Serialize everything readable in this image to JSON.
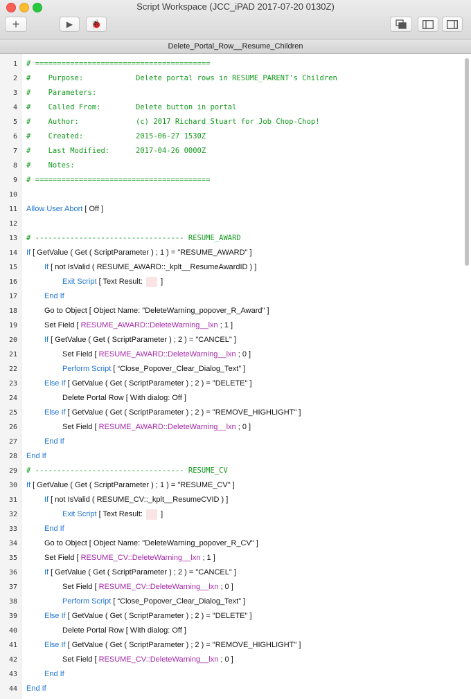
{
  "window": {
    "title": "Script Workspace (JCC_iPAD 2017-07-20 0130Z)"
  },
  "toolbar": {
    "add": "+",
    "run": "▶",
    "debug": "🐞"
  },
  "tab": {
    "label": "Delete_Portal_Row__Resume_Children"
  },
  "script": {
    "lines": [
      {
        "n": "1",
        "indent": 0,
        "segs": [
          {
            "c": "comment",
            "t": "# ========================================"
          }
        ]
      },
      {
        "n": "2",
        "indent": 0,
        "segs": [
          {
            "c": "comment",
            "t": "#    Purpose:            Delete portal rows in RESUME_PARENT's Children"
          }
        ]
      },
      {
        "n": "3",
        "indent": 0,
        "segs": [
          {
            "c": "comment",
            "t": "#    Parameters:"
          }
        ]
      },
      {
        "n": "4",
        "indent": 0,
        "segs": [
          {
            "c": "comment",
            "t": "#    Called From:        Delete button in portal"
          }
        ]
      },
      {
        "n": "5",
        "indent": 0,
        "segs": [
          {
            "c": "comment",
            "t": "#    Author:             (c) 2017 Richard Stuart for Job Chop-Chop!"
          }
        ]
      },
      {
        "n": "6",
        "indent": 0,
        "segs": [
          {
            "c": "comment",
            "t": "#    Created:            2015-06-27 1530Z"
          }
        ]
      },
      {
        "n": "7",
        "indent": 0,
        "segs": [
          {
            "c": "comment",
            "t": "#    Last Modified:      2017-04-26 0000Z"
          }
        ]
      },
      {
        "n": "8",
        "indent": 0,
        "segs": [
          {
            "c": "comment",
            "t": "#    Notes:"
          }
        ]
      },
      {
        "n": "9",
        "indent": 0,
        "segs": [
          {
            "c": "comment",
            "t": "# ========================================"
          }
        ]
      },
      {
        "n": "10",
        "indent": 0,
        "segs": []
      },
      {
        "n": "11",
        "indent": 0,
        "segs": [
          {
            "c": "kw",
            "t": "Allow User Abort"
          },
          {
            "c": "",
            "t": " [ Off ]"
          }
        ]
      },
      {
        "n": "12",
        "indent": 0,
        "segs": []
      },
      {
        "n": "13",
        "indent": 0,
        "segs": [
          {
            "c": "comment",
            "t": "# ---------------------------------- RESUME_AWARD"
          }
        ]
      },
      {
        "n": "14",
        "indent": 0,
        "segs": [
          {
            "c": "kw",
            "t": "If"
          },
          {
            "c": "",
            "t": " [ GetValue ( Get ( ScriptParameter ) ; 1 ) = \"RESUME_AWARD\" ]"
          }
        ]
      },
      {
        "n": "15",
        "indent": 1,
        "segs": [
          {
            "c": "kw",
            "t": "If"
          },
          {
            "c": "",
            "t": " [ not IsValid ( RESUME_AWARD::_kplt__ResumeAwardID ) ]"
          }
        ]
      },
      {
        "n": "16",
        "indent": 2,
        "segs": [
          {
            "c": "kw",
            "t": "Exit Script"
          },
          {
            "c": "",
            "t": " [ Text Result: "
          },
          {
            "c": "box",
            "t": ""
          },
          {
            "c": "",
            "t": " ]"
          }
        ]
      },
      {
        "n": "17",
        "indent": 1,
        "segs": [
          {
            "c": "kw",
            "t": "End If"
          }
        ]
      },
      {
        "n": "18",
        "indent": 1,
        "segs": [
          {
            "c": "",
            "t": "Go to Object [ Object Name: \"DeleteWarning_popover_R_Award\" ]"
          }
        ]
      },
      {
        "n": "19",
        "indent": 1,
        "segs": [
          {
            "c": "",
            "t": "Set Field [ "
          },
          {
            "c": "fld",
            "t": "RESUME_AWARD::DeleteWarning__lxn"
          },
          {
            "c": "",
            "t": " ; 1 ]"
          }
        ]
      },
      {
        "n": "20",
        "indent": 1,
        "segs": [
          {
            "c": "kw",
            "t": "If"
          },
          {
            "c": "",
            "t": " [ GetValue ( Get ( ScriptParameter ) ; 2 ) = \"CANCEL\" ]"
          }
        ]
      },
      {
        "n": "21",
        "indent": 2,
        "segs": [
          {
            "c": "",
            "t": "Set Field [ "
          },
          {
            "c": "fld",
            "t": "RESUME_AWARD::DeleteWarning__lxn"
          },
          {
            "c": "",
            "t": " ; 0 ]"
          }
        ]
      },
      {
        "n": "22",
        "indent": 2,
        "segs": [
          {
            "c": "kw",
            "t": "Perform Script"
          },
          {
            "c": "",
            "t": " [ “Close_Popover_Clear_Dialog_Text” ]"
          }
        ]
      },
      {
        "n": "23",
        "indent": 1,
        "segs": [
          {
            "c": "kw",
            "t": "Else If"
          },
          {
            "c": "",
            "t": " [ GetValue ( Get ( ScriptParameter ) ; 2 ) = \"DELETE\" ]"
          }
        ]
      },
      {
        "n": "24",
        "indent": 2,
        "segs": [
          {
            "c": "",
            "t": "Delete Portal Row [ With dialog: Off ]"
          }
        ]
      },
      {
        "n": "25",
        "indent": 1,
        "segs": [
          {
            "c": "kw",
            "t": "Else If"
          },
          {
            "c": "",
            "t": " [ GetValue ( Get ( ScriptParameter ) ; 2 ) = \"REMOVE_HIGHLIGHT\" ]"
          }
        ]
      },
      {
        "n": "26",
        "indent": 2,
        "segs": [
          {
            "c": "",
            "t": "Set Field [ "
          },
          {
            "c": "fld",
            "t": "RESUME_AWARD::DeleteWarning__lxn"
          },
          {
            "c": "",
            "t": " ; 0 ]"
          }
        ]
      },
      {
        "n": "27",
        "indent": 1,
        "segs": [
          {
            "c": "kw",
            "t": "End If"
          }
        ]
      },
      {
        "n": "28",
        "indent": 0,
        "segs": [
          {
            "c": "kw",
            "t": "End If"
          }
        ]
      },
      {
        "n": "29",
        "indent": 0,
        "segs": [
          {
            "c": "comment",
            "t": "# ---------------------------------- RESUME_CV"
          }
        ]
      },
      {
        "n": "30",
        "indent": 0,
        "segs": [
          {
            "c": "kw",
            "t": "If"
          },
          {
            "c": "",
            "t": " [ GetValue ( Get ( ScriptParameter ) ; 1 ) = \"RESUME_CV\" ]"
          }
        ]
      },
      {
        "n": "31",
        "indent": 1,
        "segs": [
          {
            "c": "kw",
            "t": "If"
          },
          {
            "c": "",
            "t": " [ not IsValid ( RESUME_CV::_kplt__ResumeCVID ) ]"
          }
        ]
      },
      {
        "n": "32",
        "indent": 2,
        "segs": [
          {
            "c": "kw",
            "t": "Exit Script"
          },
          {
            "c": "",
            "t": " [ Text Result: "
          },
          {
            "c": "box",
            "t": ""
          },
          {
            "c": "",
            "t": " ]"
          }
        ]
      },
      {
        "n": "33",
        "indent": 1,
        "segs": [
          {
            "c": "kw",
            "t": "End If"
          }
        ]
      },
      {
        "n": "34",
        "indent": 1,
        "segs": [
          {
            "c": "",
            "t": "Go to Object [ Object Name: \"DeleteWarning_popover_R_CV\" ]"
          }
        ]
      },
      {
        "n": "35",
        "indent": 1,
        "segs": [
          {
            "c": "",
            "t": "Set Field [ "
          },
          {
            "c": "fld",
            "t": "RESUME_CV::DeleteWarning__lxn"
          },
          {
            "c": "",
            "t": " ; 1 ]"
          }
        ]
      },
      {
        "n": "36",
        "indent": 1,
        "segs": [
          {
            "c": "kw",
            "t": "If"
          },
          {
            "c": "",
            "t": " [ GetValue ( Get ( ScriptParameter ) ; 2 ) = \"CANCEL\" ]"
          }
        ]
      },
      {
        "n": "37",
        "indent": 2,
        "segs": [
          {
            "c": "",
            "t": "Set Field [ "
          },
          {
            "c": "fld",
            "t": "RESUME_CV::DeleteWarning__lxn"
          },
          {
            "c": "",
            "t": " ; 0 ]"
          }
        ]
      },
      {
        "n": "38",
        "indent": 2,
        "segs": [
          {
            "c": "kw",
            "t": "Perform Script"
          },
          {
            "c": "",
            "t": " [ “Close_Popover_Clear_Dialog_Text” ]"
          }
        ]
      },
      {
        "n": "39",
        "indent": 1,
        "segs": [
          {
            "c": "kw",
            "t": "Else If"
          },
          {
            "c": "",
            "t": " [ GetValue ( Get ( ScriptParameter ) ; 2 ) = \"DELETE\" ]"
          }
        ]
      },
      {
        "n": "40",
        "indent": 2,
        "segs": [
          {
            "c": "",
            "t": "Delete Portal Row [ With dialog: Off ]"
          }
        ]
      },
      {
        "n": "41",
        "indent": 1,
        "segs": [
          {
            "c": "kw",
            "t": "Else If"
          },
          {
            "c": "",
            "t": " [ GetValue ( Get ( ScriptParameter ) ; 2 ) = \"REMOVE_HIGHLIGHT\" ]"
          }
        ]
      },
      {
        "n": "42",
        "indent": 2,
        "segs": [
          {
            "c": "",
            "t": "Set Field [ "
          },
          {
            "c": "fld",
            "t": "RESUME_CV::DeleteWarning__lxn"
          },
          {
            "c": "",
            "t": " ; 0 ]"
          }
        ]
      },
      {
        "n": "43",
        "indent": 1,
        "segs": [
          {
            "c": "kw",
            "t": "End If"
          }
        ]
      },
      {
        "n": "44",
        "indent": 0,
        "segs": [
          {
            "c": "kw",
            "t": "End If"
          }
        ]
      }
    ]
  }
}
